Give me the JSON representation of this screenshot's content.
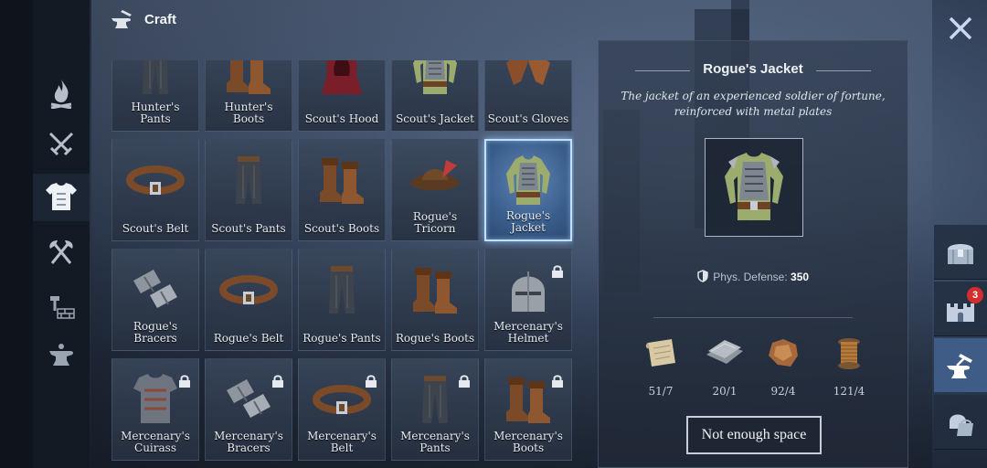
{
  "header": {
    "title": "Craft",
    "icon": "anvil-hammer-icon"
  },
  "sidebar": {
    "items": [
      {
        "name": "campfire",
        "icon": "campfire-icon"
      },
      {
        "name": "weapons",
        "icon": "crossed-swords-icon"
      },
      {
        "name": "armor",
        "icon": "armor-icon",
        "active": true
      },
      {
        "name": "tools",
        "icon": "crossed-axes-icon"
      },
      {
        "name": "construction",
        "icon": "hammer-bricks-icon"
      },
      {
        "name": "workbench",
        "icon": "anvil-icon"
      }
    ]
  },
  "grid": {
    "items": [
      {
        "label": "Hunter's Pants",
        "icon": "pants-icon",
        "locked": false
      },
      {
        "label": "Hunter's Boots",
        "icon": "boots-icon",
        "locked": false
      },
      {
        "label": "Scout's Hood",
        "icon": "hood-icon",
        "locked": false
      },
      {
        "label": "Scout's Jacket",
        "icon": "jacket-icon",
        "locked": false
      },
      {
        "label": "Scout's Gloves",
        "icon": "gloves-icon",
        "locked": false
      },
      {
        "label": "Scout's Belt",
        "icon": "belt-icon",
        "locked": false
      },
      {
        "label": "Scout's Pants",
        "icon": "pants-icon",
        "locked": false
      },
      {
        "label": "Scout's Boots",
        "icon": "boots-icon",
        "locked": false
      },
      {
        "label": "Rogue's Tricorn",
        "icon": "tricorn-hat-icon",
        "locked": false
      },
      {
        "label": "Rogue's Jacket",
        "icon": "jacket-icon",
        "locked": false,
        "selected": true
      },
      {
        "label": "Rogue's Bracers",
        "icon": "bracers-icon",
        "locked": false
      },
      {
        "label": "Rogue's Belt",
        "icon": "belt-icon",
        "locked": false
      },
      {
        "label": "Rogue's Pants",
        "icon": "pants-icon",
        "locked": false
      },
      {
        "label": "Rogue's Boots",
        "icon": "boots-icon",
        "locked": false
      },
      {
        "label": "Mercenary's Helmet",
        "icon": "helmet-icon",
        "locked": true
      },
      {
        "label": "Mercenary's Cuirass",
        "icon": "cuirass-icon",
        "locked": true
      },
      {
        "label": "Mercenary's Bracers",
        "icon": "bracers-icon",
        "locked": true
      },
      {
        "label": "Mercenary's Belt",
        "icon": "belt-icon",
        "locked": true
      },
      {
        "label": "Mercenary's Pants",
        "icon": "pants-icon",
        "locked": true
      },
      {
        "label": "Mercenary's Boots",
        "icon": "boots-icon",
        "locked": true
      }
    ]
  },
  "detail": {
    "title": "Rogue's Jacket",
    "description": "The jacket of an experienced soldier of fortune, reinforced with metal plates",
    "stat_label": "Phys. Defense:",
    "stat_value": "350",
    "stat_icon": "shield-icon",
    "materials": [
      {
        "icon": "parchment-scroll-icon",
        "count": "51/7"
      },
      {
        "icon": "metal-plates-icon",
        "count": "20/1"
      },
      {
        "icon": "leather-hide-icon",
        "count": "92/4"
      },
      {
        "icon": "thread-spool-icon",
        "count": "121/4"
      }
    ],
    "action_label": "Not enough space"
  },
  "right_bar": {
    "items": [
      {
        "icon": "treasure-chest-icon"
      },
      {
        "icon": "castle-icon",
        "badge": "3"
      },
      {
        "icon": "anvil-hammer-icon",
        "active": true
      },
      {
        "icon": "helmet-bag-icon"
      }
    ]
  },
  "colors": {
    "selected_border": "#bfe0ff",
    "badge": "#d42d2d",
    "active_tab": "#3f5c86"
  }
}
